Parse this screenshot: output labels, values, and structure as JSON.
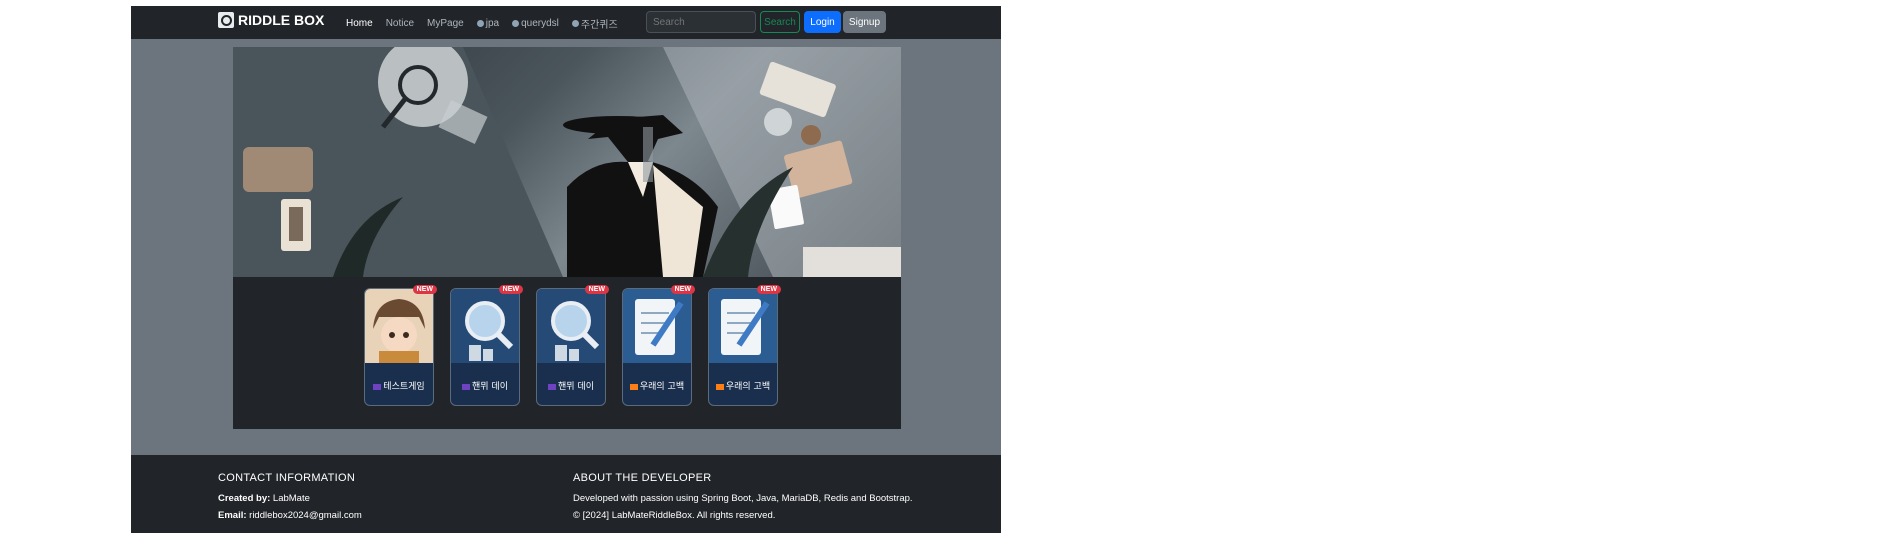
{
  "navbar": {
    "brand": "RIDDLE BOX",
    "links": [
      {
        "label": "Home",
        "active": true,
        "dot": false
      },
      {
        "label": "Notice",
        "active": false,
        "dot": false
      },
      {
        "label": "MyPage",
        "active": false,
        "dot": false
      },
      {
        "label": "jpa",
        "active": false,
        "dot": true
      },
      {
        "label": "querydsl",
        "active": false,
        "dot": true
      },
      {
        "label": "주간퀴즈",
        "active": false,
        "dot": true
      }
    ],
    "search_placeholder": "Search",
    "search_label": "Search",
    "login_label": "Login",
    "signup_label": "Signup"
  },
  "games": [
    {
      "title": "테스트게임",
      "badge": "NEW",
      "flag_color": "#6f42c1",
      "icon": "detective-avatar-icon"
    },
    {
      "title": "핸뮈 데이",
      "badge": "NEW",
      "flag_color": "#6f42c1",
      "icon": "magnifier-city-icon"
    },
    {
      "title": "핸뮈 데이",
      "badge": "NEW",
      "flag_color": "#6f42c1",
      "icon": "magnifier-city-icon"
    },
    {
      "title": "우래의 고백",
      "badge": "NEW",
      "flag_color": "#fd7e14",
      "icon": "notepad-pen-icon"
    },
    {
      "title": "우래의 고백",
      "badge": "NEW",
      "flag_color": "#fd7e14",
      "icon": "notepad-pen-icon"
    }
  ],
  "footer": {
    "contact_heading": "CONTACT INFORMATION",
    "created_by_label": "Created by:",
    "created_by_value": "LabMate",
    "email_label": "Email:",
    "email_value": "riddlebox2024@gmail.com",
    "about_heading": "ABOUT THE DEVELOPER",
    "about_text": "Developed with passion using Spring Boot, Java, MariaDB, Redis and Bootstrap.",
    "copyright": "© [2024] LabMateRiddleBox. All rights reserved."
  },
  "colors": {
    "navbar_bg": "#212529",
    "page_bg": "#6c757d",
    "primary": "#0d6efd",
    "success": "#198754",
    "danger": "#dc3545"
  }
}
